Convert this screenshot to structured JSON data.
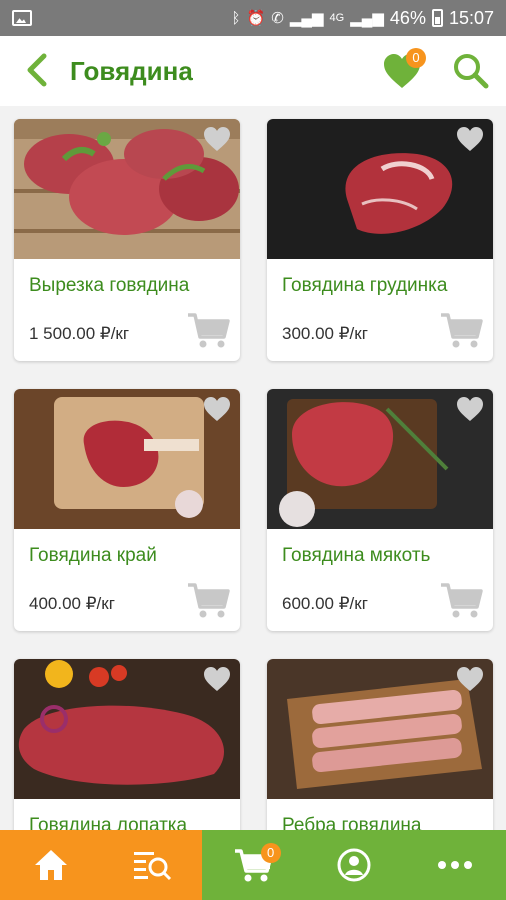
{
  "status_bar": {
    "battery": "46%",
    "time": "15:07",
    "network": "4G"
  },
  "header": {
    "title": "Говядина",
    "favorites_count": "0"
  },
  "products": [
    {
      "name": "Вырезка говядина",
      "price": "1 500.00 ₽/кг",
      "icon": "beef-tenderloin-photo"
    },
    {
      "name": "Говядина грудинка",
      "price": "300.00 ₽/кг",
      "icon": "beef-brisket-photo"
    },
    {
      "name": "Говядина край",
      "price": "400.00 ₽/кг",
      "icon": "beef-rib-steak-photo"
    },
    {
      "name": "Говядина мякоть",
      "price": "600.00 ₽/кг",
      "icon": "beef-flesh-photo"
    },
    {
      "name": "Говядина лопатка",
      "price": "",
      "icon": "beef-shoulder-photo"
    },
    {
      "name": "Ребра говядина",
      "price": "",
      "icon": "beef-ribs-photo"
    }
  ],
  "bottom_nav": {
    "cart_count": "0",
    "items": [
      "home-icon",
      "catalog-search-icon",
      "cart-icon",
      "profile-icon",
      "more-icon"
    ]
  },
  "colors": {
    "green": "#3d8c1e",
    "orange": "#f7941d",
    "light_green": "#6fb23a",
    "status_bar": "#7a7a7a"
  }
}
